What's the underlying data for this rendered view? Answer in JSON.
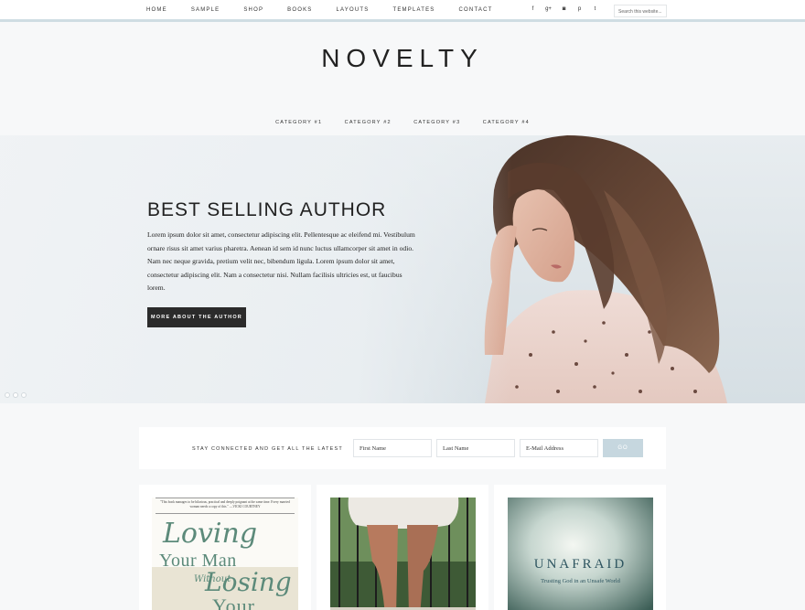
{
  "nav": {
    "items": [
      "HOME",
      "SAMPLE",
      "SHOP",
      "BOOKS",
      "LAYOUTS",
      "TEMPLATES",
      "CONTACT"
    ],
    "social_icons": [
      "facebook-icon",
      "google-plus-icon",
      "instagram-icon",
      "pinterest-icon",
      "twitter-icon"
    ],
    "social_glyphs": [
      "f",
      "g+",
      "◙",
      "p",
      "t"
    ],
    "search_placeholder": "Search this website..."
  },
  "header": {
    "title": "NOVELTY",
    "categories": [
      "CATEGORY #1",
      "CATEGORY #2",
      "CATEGORY #3",
      "CATEGORY #4"
    ]
  },
  "hero": {
    "title": "BEST SELLING AUTHOR",
    "body": "Lorem ipsum dolor sit amet, consectetur adipiscing elit. Pellentesque ac eleifend mi. Vestibulum ornare risus sit amet varius pharetra. Aenean id sem id nunc luctus ullamcorper sit amet in odio. Nam nec neque gravida, pretium velit nec, bibendum ligula. Lorem ipsum dolor sit amet, consectetur adipiscing elit. Nam a consectetur nisi. Nullam facilisis ultricies est, ut faucibus lorem.",
    "button": "MORE ABOUT THE AUTHOR",
    "slides": 3,
    "active_slide": 2
  },
  "newsletter": {
    "label": "STAY CONNECTED AND GET ALL THE LATEST",
    "first_name": "First Name",
    "last_name": "Last Name",
    "email": "E-Mail Address",
    "button": "GO"
  },
  "books": [
    {
      "quote": "\"This book manages to be hilarious, practical and deeply poignant at the same time. Every married woman needs a copy of this.\" —VICKI COURTNEY",
      "title_line1": "Loving",
      "title_line2": "Your Man",
      "title_line3": "Without",
      "title_line4": "Losing",
      "title_line5": "Your"
    },
    {
      "title": ""
    },
    {
      "title": "UNAFRAID",
      "subtitle": "Trusting God in an Unsafe World"
    }
  ],
  "colors": {
    "accent": "#cfdde3",
    "button_dark": "#2b2b2b",
    "go_button": "#c6d7df",
    "book1_text": "#5c8a7a",
    "book3_text": "#2e5560"
  }
}
